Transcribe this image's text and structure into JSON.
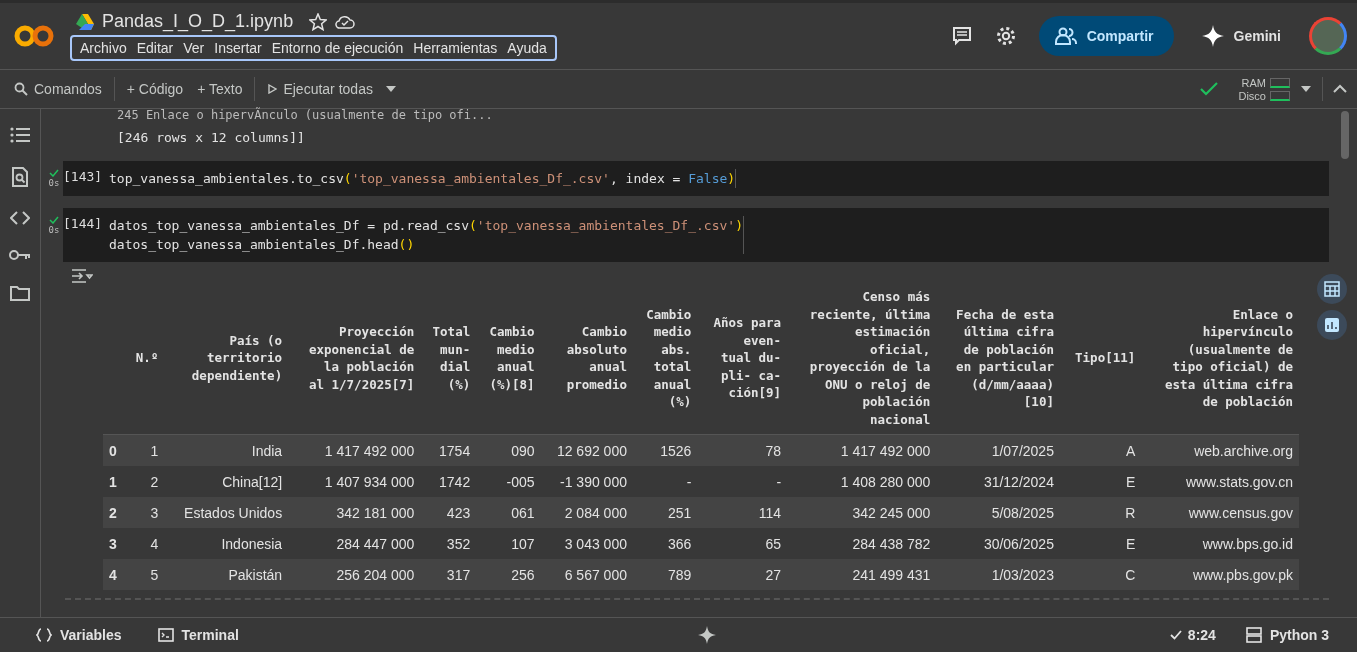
{
  "header": {
    "title": "Pandas_I_O_D_1.ipynb",
    "menu": [
      "Archivo",
      "Editar",
      "Ver",
      "Insertar",
      "Entorno de ejecución",
      "Herramientas",
      "Ayuda"
    ],
    "share": "Compartir",
    "gemini": "Gemini"
  },
  "toolbar": {
    "commands": "Comandos",
    "add_code": "+ Código",
    "add_text": "+ Texto",
    "run_all": "Ejecutar todas",
    "ram": "RAM",
    "disk": "Disco"
  },
  "prev_output": [
    "245  Enlace o hipervÃnculo (usualmente de tipo ofi...",
    "[246 rows x 12 columns]]"
  ],
  "cells": [
    {
      "number": "[143]",
      "time": "0s",
      "lines": [
        [
          {
            "text": "top_vanessa_ambientales.to_csv",
            "kind": "plain"
          },
          {
            "text": "(",
            "kind": "paren"
          },
          {
            "text": "'top_vanessa_ambientales_Df_.csv'",
            "kind": "string"
          },
          {
            "text": ", index = ",
            "kind": "plain"
          },
          {
            "text": "False",
            "kind": "keyword"
          },
          {
            "text": ")",
            "kind": "paren"
          }
        ]
      ]
    },
    {
      "number": "[144]",
      "time": "0s",
      "lines": [
        [
          {
            "text": "datos_top_vanessa_ambientales_Df = pd.read_csv",
            "kind": "plain"
          },
          {
            "text": "(",
            "kind": "paren"
          },
          {
            "text": "'top_vanessa_ambientales_Df_.csv'",
            "kind": "string"
          },
          {
            "text": ")",
            "kind": "paren"
          }
        ],
        [
          {
            "text": "datos_top_vanessa_ambientales_Df.head",
            "kind": "plain"
          },
          {
            "text": "()",
            "kind": "paren"
          }
        ]
      ]
    }
  ],
  "table": {
    "columns": [
      "",
      "N.º",
      "País (o\nterritorio\ndependiente)",
      "Proyección\nexponencial de\nla población\nal 1/7/2025[7]",
      "Total\nmun-\ndial\n(%)",
      "Cambio\nmedio\nanual\n(%)[8]",
      "Cambio\nabsoluto\nanual\npromedio",
      "Cambio\nmedio\nabs.\ntotal\nanual\n(%)",
      "Años para\neven-\ntual du-\npli- ca-\nción[9]",
      "Censo más\nreciente, última\nestimación\noficial,\nproyección de la\nONU o reloj de\npoblación\nnacional",
      "Fecha de esta\núltima cifra\nde población\nen particular\n(d/mm/aaaa)\n[10]",
      "Tipo[11]",
      "Enlace o\nhipervínculo\n(usualmente de\ntipo oficial) de\nesta última cifra\nde población"
    ],
    "rows": [
      [
        "0",
        "1",
        "India",
        "1 417 492 000",
        "1754",
        "090",
        "12 692 000",
        "1526",
        "78",
        "1 417 492 000",
        "1/07/2025",
        "A",
        "web.archive.org"
      ],
      [
        "1",
        "2",
        "China[12]",
        "1 407 934 000",
        "1742",
        "-005",
        "-1 390 000",
        "-",
        "-",
        "1 408 280 000",
        "31/12/2024",
        "E",
        "www.stats.gov.cn"
      ],
      [
        "2",
        "3",
        "Estados Unidos",
        "342 181 000",
        "423",
        "061",
        "2 084 000",
        "251",
        "114",
        "342 245 000",
        "5/08/2025",
        "R",
        "www.census.gov"
      ],
      [
        "3",
        "4",
        "Indonesia",
        "284 447 000",
        "352",
        "107",
        "3 043 000",
        "366",
        "65",
        "284 438 782",
        "30/06/2025",
        "E",
        "www.bps.go.id"
      ],
      [
        "4",
        "5",
        "Pakistán",
        "256 204 000",
        "317",
        "256",
        "6 567 000",
        "789",
        "27",
        "241 499 431",
        "1/03/2023",
        "C",
        "www.pbs.gov.pk"
      ]
    ]
  },
  "status_bar": {
    "variables": "Variables",
    "terminal": "Terminal",
    "time": "8:24",
    "runtime": "Python 3"
  }
}
